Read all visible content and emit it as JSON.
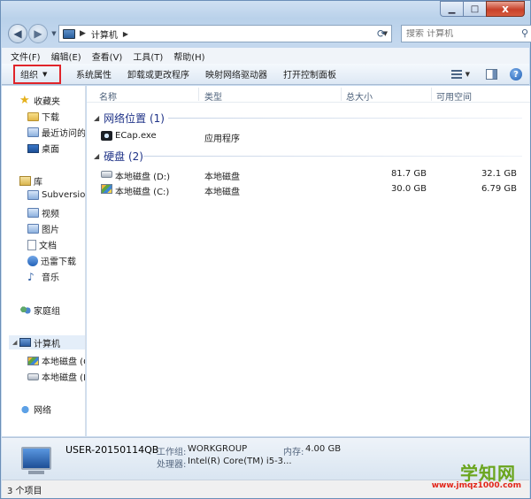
{
  "window": {
    "controls": {
      "minimize_icon": "minimize-icon",
      "maximize_icon": "maximize-icon",
      "close_label": "x"
    }
  },
  "navigation": {
    "breadcrumb": "计算机",
    "search_placeholder": "搜索 计算机"
  },
  "menu": [
    "文件(F)",
    "编辑(E)",
    "查看(V)",
    "工具(T)",
    "帮助(H)"
  ],
  "commands": {
    "organize": "组织",
    "items": [
      "系统属性",
      "卸载或更改程序",
      "映射网络驱动器",
      "打开控制面板"
    ]
  },
  "sidebar": {
    "favorites": {
      "label": "收藏夹",
      "items": [
        "下载",
        "最近访问的",
        "桌面"
      ]
    },
    "libraries": {
      "label": "库",
      "items": [
        "Subversion",
        "视频",
        "图片",
        "文档",
        "迅雷下载",
        "音乐"
      ]
    },
    "homegroup": "家庭组",
    "computer": {
      "label": "计算机",
      "items": [
        "本地磁盘 (C",
        "本地磁盘 (D"
      ]
    },
    "network": "网络"
  },
  "columns": {
    "name": "名称",
    "type": "类型",
    "total": "总大小",
    "free": "可用空间"
  },
  "groups": {
    "network": {
      "label": "网络位置 (1)",
      "items": [
        {
          "name": "ECap.exe",
          "type": "应用程序"
        }
      ]
    },
    "disks": {
      "label": "硬盘 (2)",
      "items": [
        {
          "name": "本地磁盘 (D:)",
          "type": "本地磁盘",
          "total": "81.7 GB",
          "free": "32.1 GB"
        },
        {
          "name": "本地磁盘 (C:)",
          "type": "本地磁盘",
          "total": "30.0 GB",
          "free": "6.79 GB"
        }
      ]
    }
  },
  "details": {
    "computer_name": "USER-20150114QB",
    "workgroup_label": "工作组:",
    "workgroup": "WORKGROUP",
    "memory_label": "内存:",
    "memory": "4.00 GB",
    "processor_label": "处理器:",
    "processor": "Intel(R) Core(TM) i5-3..."
  },
  "status": {
    "item_count": "3 个项目"
  },
  "watermark": {
    "top": "学知网",
    "bottom": "www.jmqz1000.com"
  },
  "colors": {
    "accent_highlight": "#e0242a",
    "group_header": "#1e3287",
    "watermark_green": "#6aa51d",
    "watermark_red": "#e2261a"
  }
}
